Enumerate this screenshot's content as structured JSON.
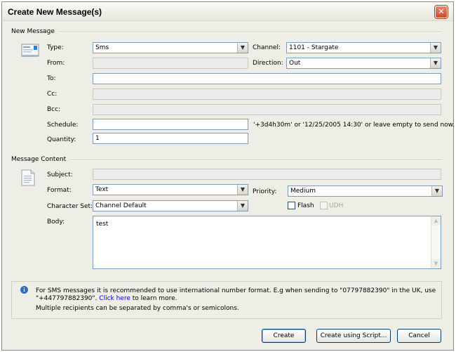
{
  "window": {
    "title": "Create New Message(s)",
    "close_glyph": "✕"
  },
  "sections": {
    "new_message": "New Message",
    "message_content": "Message Content"
  },
  "fields": {
    "type": {
      "label": "Type:",
      "value": "Sms"
    },
    "channel": {
      "label": "Channel:",
      "value": "1101 - Stargate"
    },
    "from": {
      "label": "From:",
      "value": ""
    },
    "direction": {
      "label": "Direction:",
      "value": "Out"
    },
    "to": {
      "label": "To:",
      "value": ""
    },
    "cc": {
      "label": "Cc:",
      "value": ""
    },
    "bcc": {
      "label": "Bcc:",
      "value": ""
    },
    "schedule": {
      "label": "Schedule:",
      "value": "",
      "hint": "'+3d4h30m' or '12/25/2005 14:30' or leave empty to send now."
    },
    "quantity": {
      "label": "Quantity:",
      "value": "1"
    },
    "subject": {
      "label": "Subject:",
      "value": ""
    },
    "format": {
      "label": "Format:",
      "value": "Text"
    },
    "priority": {
      "label": "Priority:",
      "value": "Medium"
    },
    "charset": {
      "label": "Character Set:",
      "value": "Channel Default"
    },
    "flash": {
      "label": "Flash",
      "checked": false
    },
    "udh": {
      "label": "UDH",
      "checked": false,
      "enabled": false
    },
    "body": {
      "label": "Body:",
      "value": "test"
    }
  },
  "info": {
    "line1": "For SMS messages it is recommended to use international number format. E.g when sending to \"07797882390\" in the UK, use",
    "line2_pre": "\"+447797882390\".",
    "line2_link": "Click here",
    "line2_post": "to learn more.",
    "line3": "Multiple recipients can be separated by comma's or semicolons."
  },
  "buttons": {
    "create": "Create",
    "create_script": "Create using Script...",
    "cancel": "Cancel"
  },
  "icons": {
    "message": "message-icon",
    "document": "document-icon",
    "info": "info-icon",
    "dropdown": "chevron-down-icon",
    "close": "close-icon"
  },
  "colors": {
    "window_bg": "#eeeee6",
    "close_button": "#d0583a",
    "field_border": "#7f9db9",
    "link": "#0000cc",
    "info_icon": "#2f6fc9"
  }
}
